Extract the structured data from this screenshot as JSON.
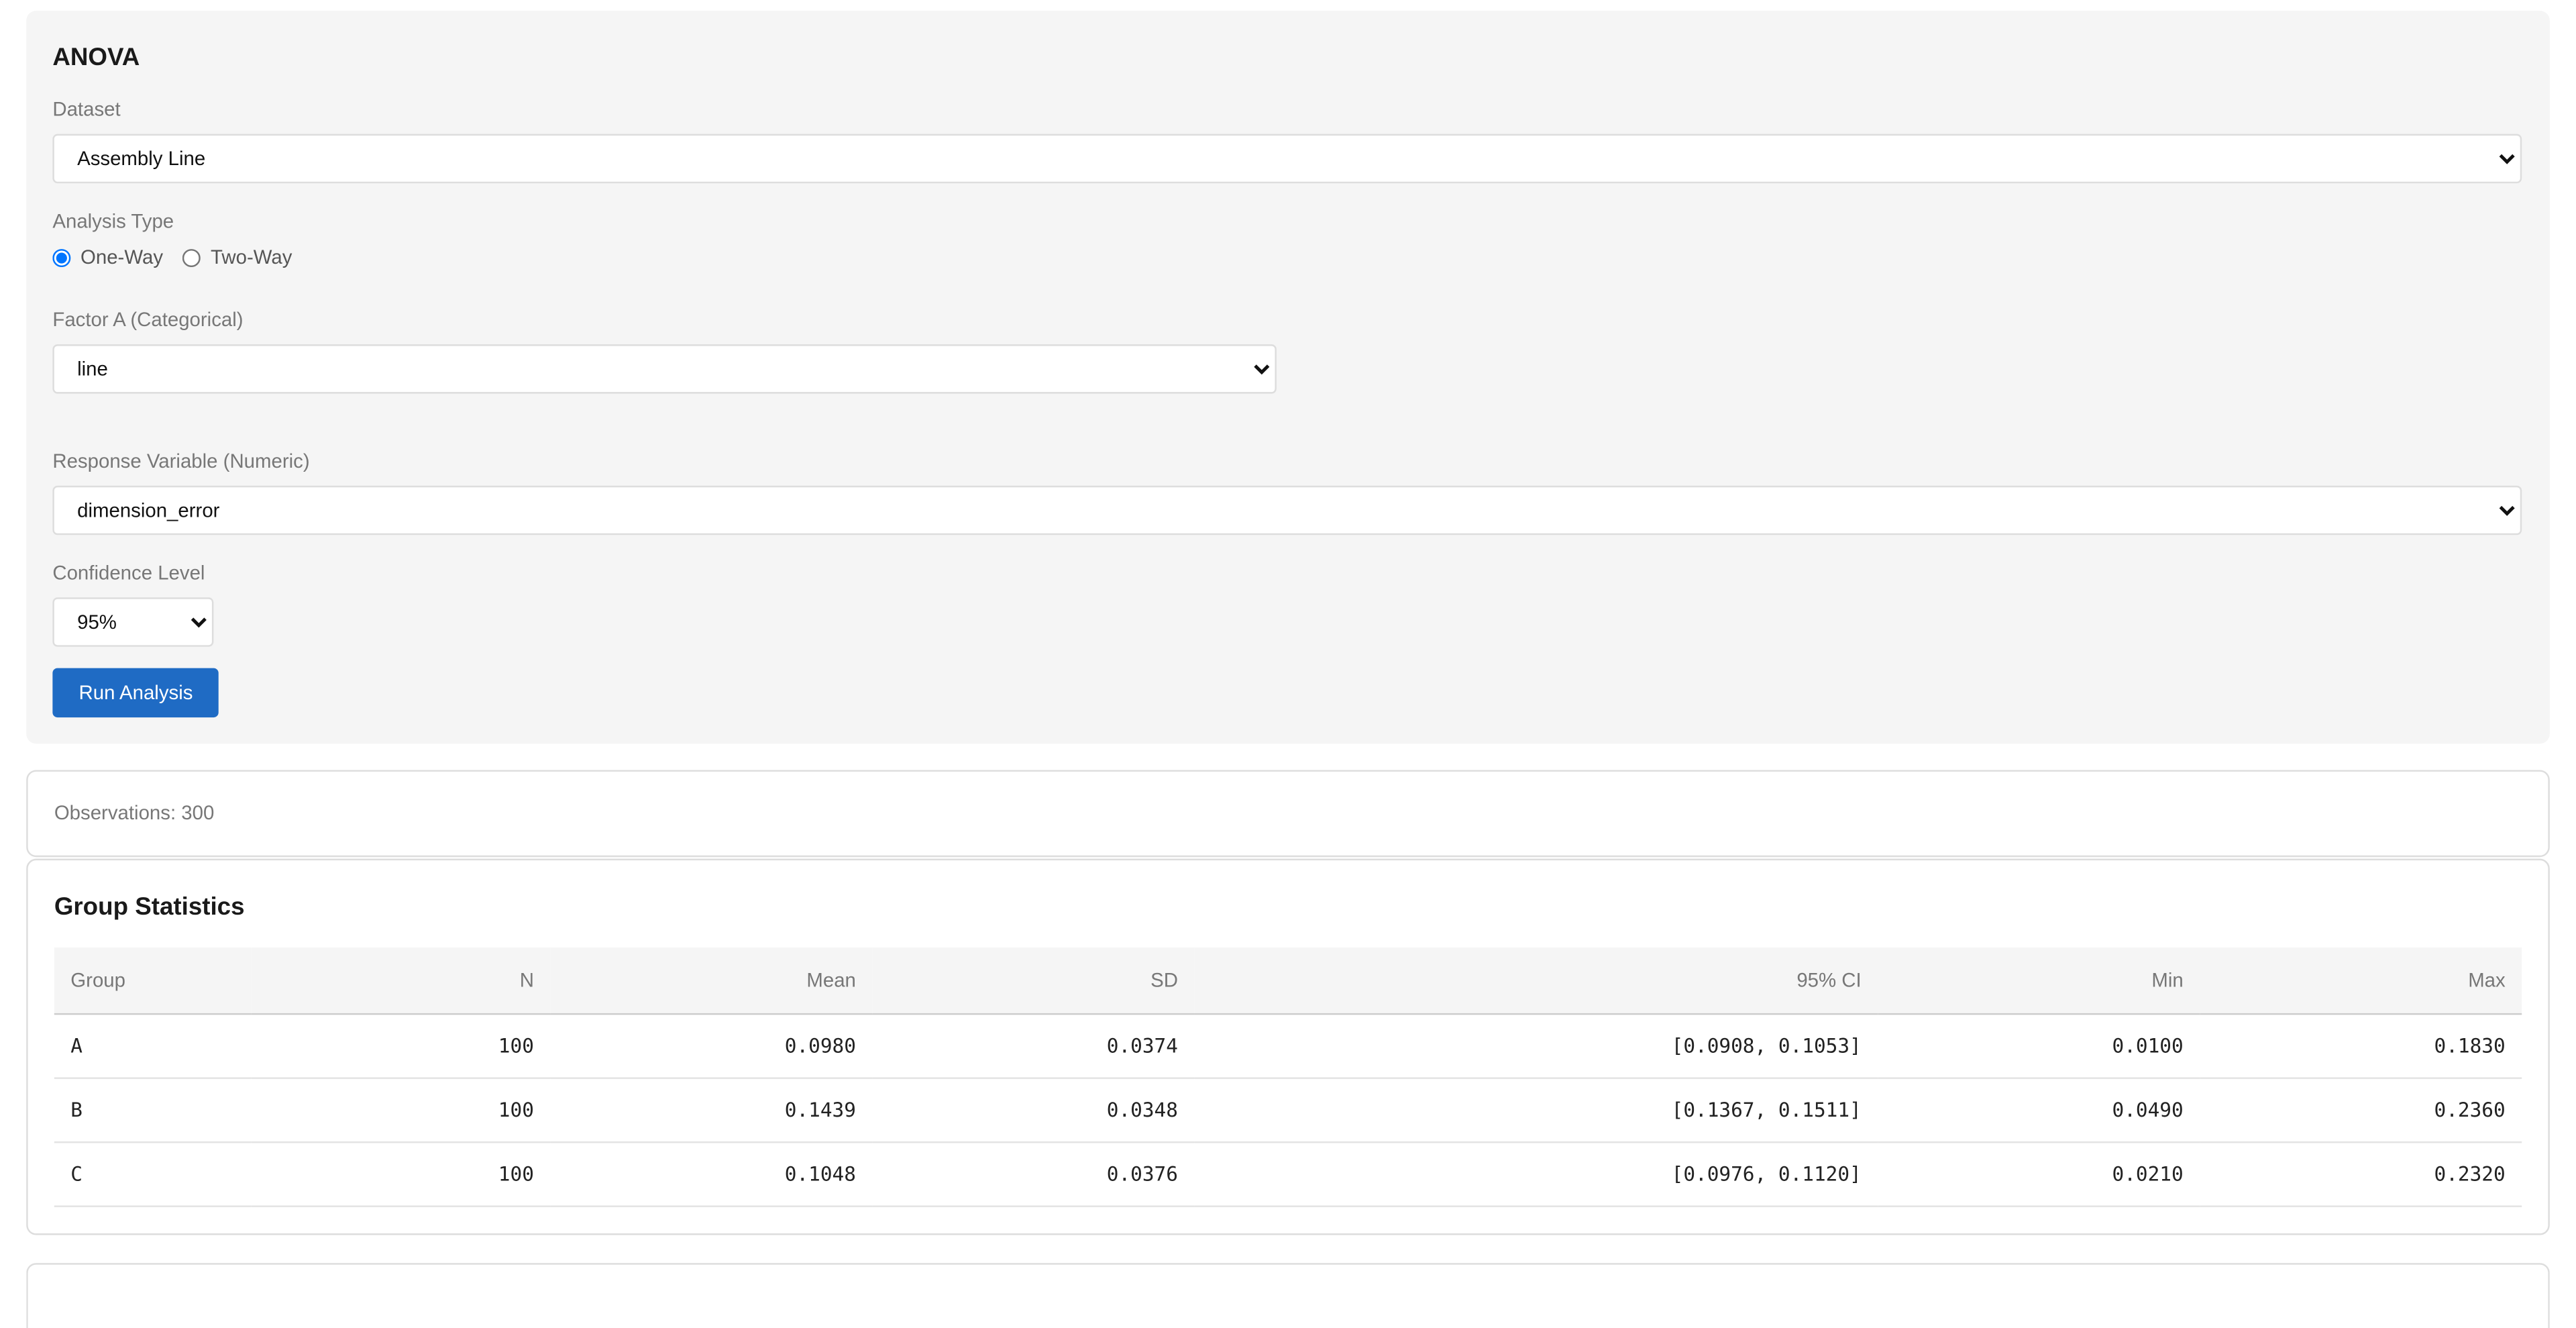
{
  "panel": {
    "title": "ANOVA",
    "dataset_label": "Dataset",
    "dataset_value": "Assembly Line",
    "analysis_type_label": "Analysis Type",
    "analysis_options": [
      "One-Way",
      "Two-Way"
    ],
    "analysis_selected": "One-Way",
    "factor_a_label": "Factor A (Categorical)",
    "factor_a_value": "line",
    "response_label": "Response Variable (Numeric)",
    "response_value": "dimension_error",
    "confidence_label": "Confidence Level",
    "confidence_value": "95%",
    "run_button_label": "Run Analysis"
  },
  "summary": {
    "observations_text": "Observations: 300"
  },
  "group_stats": {
    "title": "Group Statistics",
    "columns": [
      "Group",
      "N",
      "Mean",
      "SD",
      "95% CI",
      "Min",
      "Max"
    ],
    "rows": [
      [
        "A",
        "100",
        "0.0980",
        "0.0374",
        "[0.0908, 0.1053]",
        "0.0100",
        "0.1830"
      ],
      [
        "B",
        "100",
        "0.1439",
        "0.0348",
        "[0.1367, 0.1511]",
        "0.0490",
        "0.2360"
      ],
      [
        "C",
        "100",
        "0.1048",
        "0.0376",
        "[0.0976, 0.1120]",
        "0.0210",
        "0.2320"
      ]
    ]
  },
  "colors": {
    "accent": "#1f6bc4",
    "panel_bg": "#f5f5f5"
  }
}
